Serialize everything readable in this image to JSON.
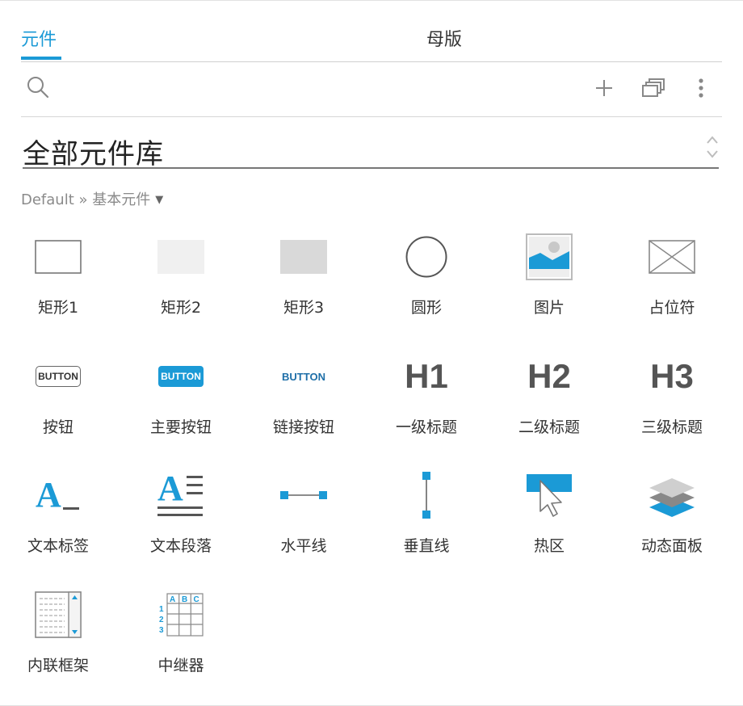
{
  "tabs": [
    {
      "label": "元件",
      "active": true
    },
    {
      "label": "母版",
      "active": false
    }
  ],
  "toolbar": {
    "icons": [
      "search-icon",
      "add-icon",
      "pages-icon",
      "more-vertical-icon"
    ]
  },
  "library": {
    "selected": "全部元件库"
  },
  "breadcrumb": {
    "text": "Default » 基本元件",
    "caret": "▼"
  },
  "widgets": [
    {
      "label": "矩形1",
      "icon": "rectangle-outline-icon"
    },
    {
      "label": "矩形2",
      "icon": "rectangle-light-icon"
    },
    {
      "label": "矩形3",
      "icon": "rectangle-gray-icon"
    },
    {
      "label": "圆形",
      "icon": "circle-icon"
    },
    {
      "label": "图片",
      "icon": "image-icon"
    },
    {
      "label": "占位符",
      "icon": "placeholder-icon"
    },
    {
      "label": "按钮",
      "icon": "button-icon",
      "icon_text": "BUTTON"
    },
    {
      "label": "主要按钮",
      "icon": "primary-button-icon",
      "icon_text": "BUTTON"
    },
    {
      "label": "链接按钮",
      "icon": "link-button-icon",
      "icon_text": "BUTTON"
    },
    {
      "label": "一级标题",
      "icon": "heading1-icon",
      "icon_text": "H1"
    },
    {
      "label": "二级标题",
      "icon": "heading2-icon",
      "icon_text": "H2"
    },
    {
      "label": "三级标题",
      "icon": "heading3-icon",
      "icon_text": "H3"
    },
    {
      "label": "文本标签",
      "icon": "text-label-icon",
      "icon_text": "A"
    },
    {
      "label": "文本段落",
      "icon": "text-paragraph-icon",
      "icon_text": "A"
    },
    {
      "label": "水平线",
      "icon": "horizontal-line-icon"
    },
    {
      "label": "垂直线",
      "icon": "vertical-line-icon"
    },
    {
      "label": "热区",
      "icon": "hotspot-icon"
    },
    {
      "label": "动态面板",
      "icon": "dynamic-panel-icon"
    },
    {
      "label": "内联框架",
      "icon": "inline-frame-icon"
    },
    {
      "label": "中继器",
      "icon": "repeater-icon",
      "icon_text_cols": [
        "A",
        "B",
        "C"
      ],
      "icon_text_rows": [
        "1",
        "2",
        "3"
      ]
    }
  ],
  "colors": {
    "accent": "#1b9ad6",
    "text": "#333333",
    "muted": "#8a8a8a"
  }
}
